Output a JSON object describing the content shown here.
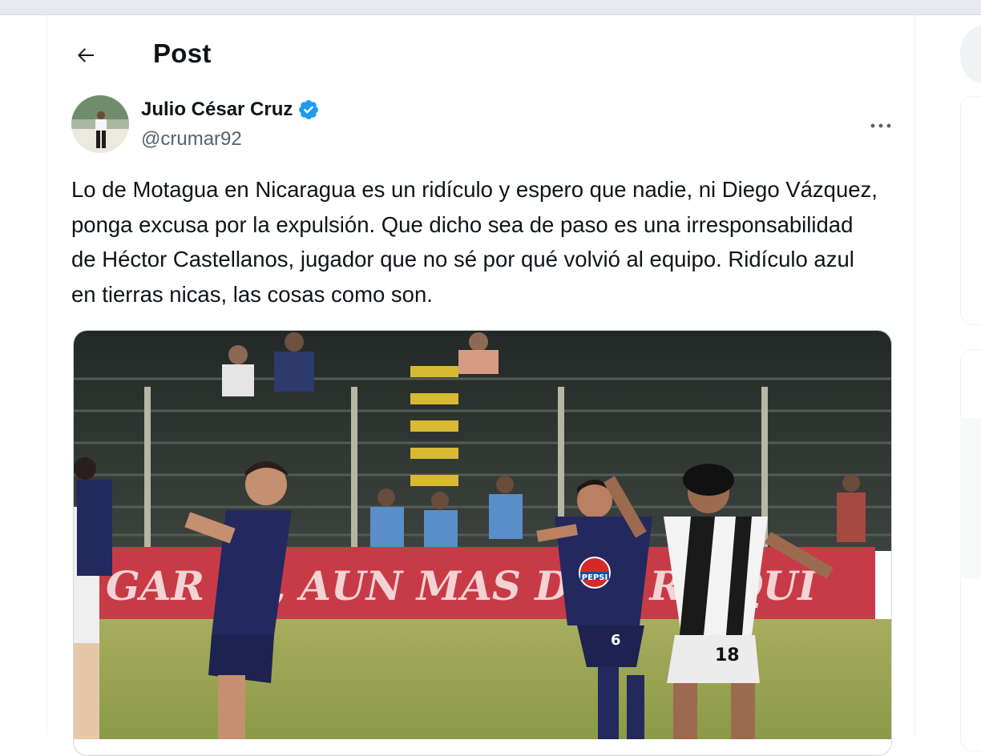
{
  "header": {
    "title": "Post"
  },
  "post": {
    "author_name": "Julio César Cruz",
    "author_handle": "@crumar92",
    "text": "Lo de Motagua en Nicaragua es un ridículo y espero que nadie, ni Diego Vázquez, ponga excusa por la expulsión. Que dicho sea de paso es una irresponsabilidad de Héctor Castellanos, jugador que no sé por qué volvió al equipo. Ridículo azul en tierras nicas, las cosas como son.",
    "media": {
      "banner_text": "GAR UI, AUN MAS DIFI R AQUI",
      "sponsor": "PEPSI",
      "player_numbers": [
        "6",
        "18"
      ]
    }
  },
  "colors": {
    "verified": "#1d9bf0",
    "muted_text": "#536471",
    "motagua_blue": "#23285f",
    "banner_red": "#c73b47"
  },
  "icons": {
    "back": "arrow-left-icon",
    "more": "more-horizontal-icon",
    "verified": "verified-badge-icon"
  }
}
